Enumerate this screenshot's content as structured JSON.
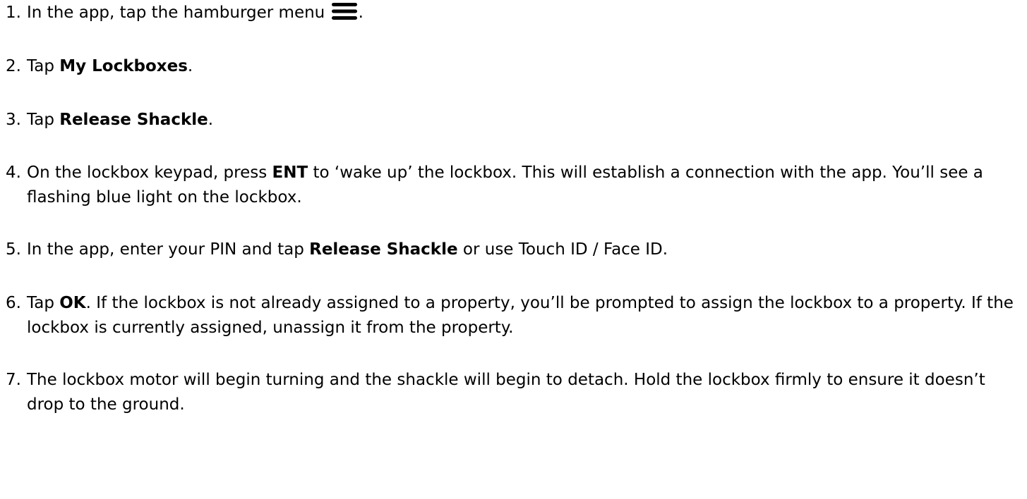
{
  "steps": [
    {
      "num": "1.",
      "pre": "In the app, tap the hamburger menu",
      "icon": "hamburger-menu-icon",
      "post": "."
    },
    {
      "num": "2.",
      "pre": "Tap ",
      "bold": "My Lockboxes",
      "post": "."
    },
    {
      "num": "3.",
      "pre": "Tap ",
      "bold": "Release Shackle",
      "post": "."
    },
    {
      "num": "4.",
      "pre": "On the lockbox keypad, press ",
      "bold": "ENT",
      "post": " to ‘wake up’ the lockbox.  This will establish a connection with the app.  You’ll see a flashing blue light on the lockbox."
    },
    {
      "num": "5.",
      "pre": "In the app, enter your PIN and tap ",
      "bold": "Release Shackle",
      "post": " or use Touch ID / Face ID."
    },
    {
      "num": "6.",
      "pre": "Tap ",
      "bold": "OK",
      "post": ".  If the lockbox is not already assigned to a property, you’ll be prompted to assign the lockbox to a property.  If the lockbox is currently assigned, unassign it from the property."
    },
    {
      "num": "7.",
      "pre": "The lockbox motor will begin turning and the shackle will begin to detach.  Hold the lockbox firmly to ensure it doesn’t drop to the ground."
    }
  ]
}
